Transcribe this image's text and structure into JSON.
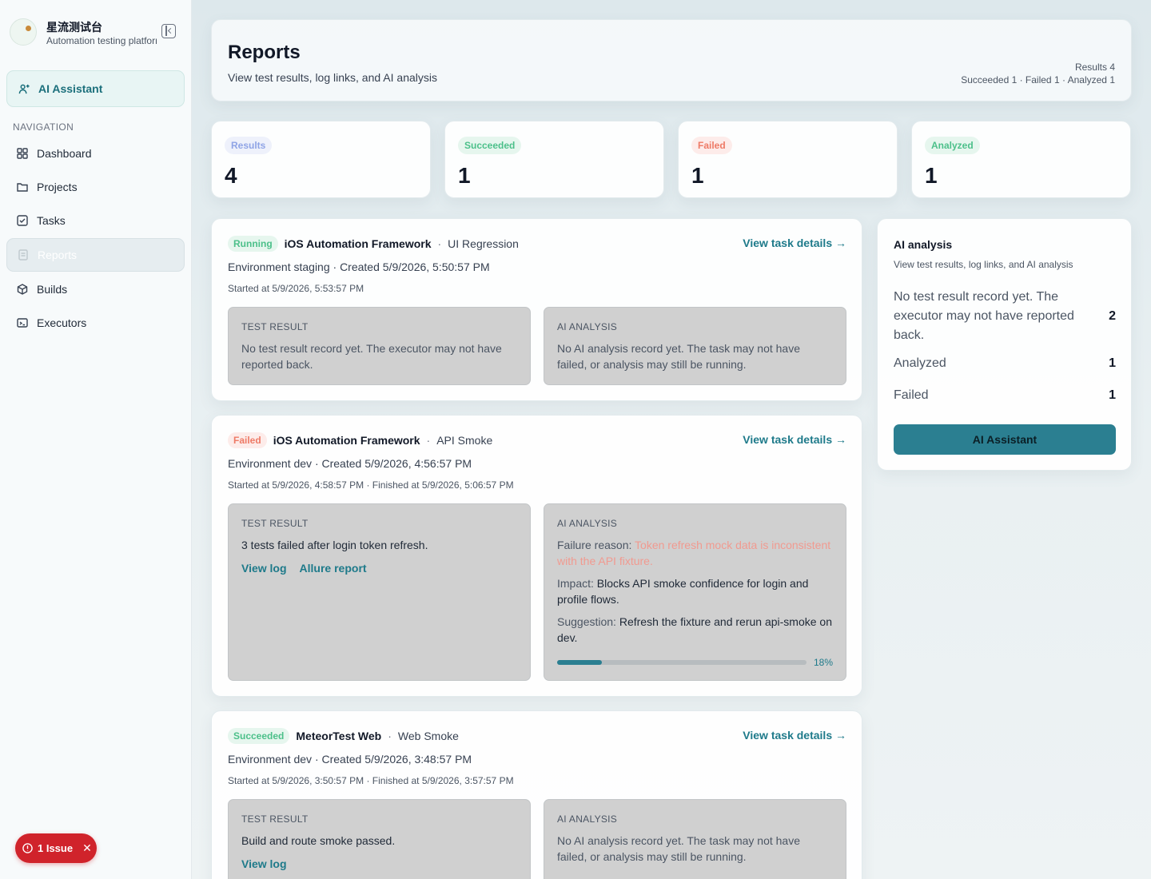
{
  "brand": {
    "name": "星流测试台",
    "subtitle": "Automation testing platform"
  },
  "sidebar": {
    "ai_label": "AI Assistant",
    "nav_heading": "NAVIGATION",
    "items": [
      {
        "label": "Dashboard",
        "icon": "grid-icon"
      },
      {
        "label": "Projects",
        "icon": "folder-icon"
      },
      {
        "label": "Tasks",
        "icon": "checkbox-icon"
      },
      {
        "label": "Reports",
        "icon": "document-icon",
        "active": true
      },
      {
        "label": "Builds",
        "icon": "cube-icon"
      },
      {
        "label": "Executors",
        "icon": "terminal-icon"
      }
    ],
    "issue_label": "1 Issue"
  },
  "header": {
    "title": "Reports",
    "subtitle": "View test results, log links, and AI analysis",
    "summary_line1": "Results 4",
    "summary_line2": "Succeeded 1 · Failed 1 · Analyzed 1"
  },
  "stats": [
    {
      "label": "Results",
      "value": "4",
      "color": "#8fa4e6"
    },
    {
      "label": "Succeeded",
      "value": "1",
      "color": "#4cc08a"
    },
    {
      "label": "Failed",
      "value": "1",
      "color": "#ee7a66"
    },
    {
      "label": "Analyzed",
      "value": "1",
      "color": "#4cc08a"
    }
  ],
  "reports": [
    {
      "status": "Running",
      "project": "iOS Automation Framework",
      "task": "UI Regression",
      "link": "View task details →",
      "env": "Environment staging · Created 5/9/2026, 5:50:57 PM",
      "time": "Started at 5/9/2026, 5:53:57 PM",
      "result_title": "TEST RESULT",
      "result_text": "No test result record yet. The executor may not have reported back.",
      "ai_title": "AI ANALYSIS",
      "ai_text": "No AI analysis record yet. The task may not have failed, or analysis may still be running."
    },
    {
      "status": "Failed",
      "project": "iOS Automation Framework",
      "task": "API Smoke",
      "link": "View task details →",
      "env": "Environment dev · Created 5/9/2026, 4:56:57 PM",
      "time": "Started at 5/9/2026, 4:58:57 PM · Finished at 5/9/2026, 5:06:57 PM",
      "result_title": "TEST RESULT",
      "result_text": "3 tests failed after login token refresh.",
      "links": [
        "View log",
        "Allure report"
      ],
      "ai_title": "AI ANALYSIS",
      "failure_reason_label": "Failure reason:",
      "failure_reason": "Token refresh mock data is inconsistent with the API fixture.",
      "impact_label": "Impact:",
      "impact": "Blocks API smoke confidence for login and profile flows.",
      "suggestion_label": "Suggestion:",
      "suggestion": "Refresh the fixture and rerun api-smoke on dev.",
      "confidence": 0.18,
      "confidence_label": "18%"
    },
    {
      "status": "Succeeded",
      "project": "MeteorTest Web",
      "task": "Web Smoke",
      "link": "View task details →",
      "env": "Environment dev · Created 5/9/2026, 3:48:57 PM",
      "time": "Started at 5/9/2026, 3:50:57 PM · Finished at 5/9/2026, 3:57:57 PM",
      "result_title": "TEST RESULT",
      "result_text": "Build and route smoke passed.",
      "links": [
        "View log"
      ],
      "ai_title": "AI ANALYSIS",
      "ai_text": "No AI analysis record yet. The task may not have failed, or analysis may still be running."
    }
  ],
  "ai_panel": {
    "title": "AI analysis",
    "subtitle": "View test results, log links, and AI analysis",
    "rows": [
      {
        "label": "No test result record yet. The executor may not have reported back.",
        "value": "2"
      },
      {
        "label": "Analyzed",
        "value": "1"
      },
      {
        "label": "Failed",
        "value": "1"
      }
    ],
    "button": "AI Assistant",
    "accent": "#2b7f91"
  }
}
